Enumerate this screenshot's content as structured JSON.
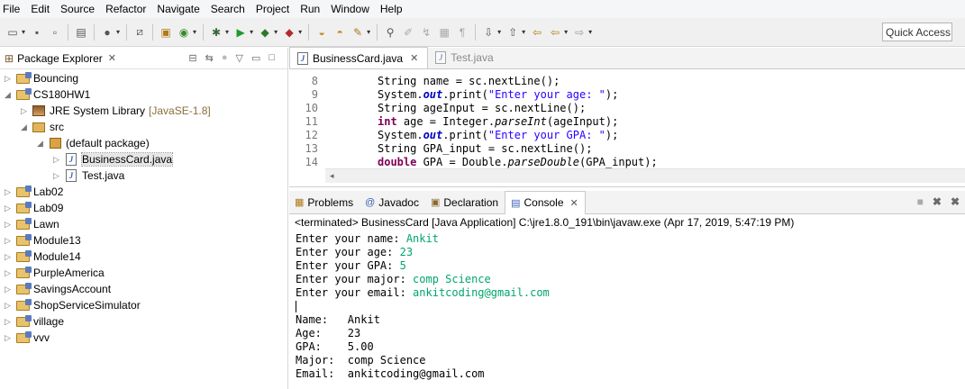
{
  "menu": [
    "File",
    "Edit",
    "Source",
    "Refactor",
    "Navigate",
    "Search",
    "Project",
    "Run",
    "Window",
    "Help"
  ],
  "toolbar": {
    "quick_access": "Quick Access"
  },
  "package_explorer": {
    "title": "Package Explorer",
    "tree": [
      {
        "label": "Bouncing",
        "extra": "",
        "icon": "project-icon",
        "arrow": "▷"
      },
      {
        "label": "CS180HW1",
        "extra": "",
        "icon": "project-icon",
        "arrow": "◢"
      },
      {
        "label": "JRE System Library",
        "extra": "[JavaSE-1.8]",
        "icon": "library-icon",
        "arrow": "▷"
      },
      {
        "label": "src",
        "extra": "",
        "icon": "source-folder-icon",
        "arrow": "◢"
      },
      {
        "label": "(default package)",
        "extra": "",
        "icon": "package-icon",
        "arrow": "◢"
      },
      {
        "label": "BusinessCard.java",
        "extra": "",
        "icon": "java-file-icon",
        "arrow": "▷"
      },
      {
        "label": "Test.java",
        "extra": "",
        "icon": "java-file-icon",
        "arrow": "▷"
      },
      {
        "label": "Lab02",
        "extra": "",
        "icon": "project-icon",
        "arrow": "▷"
      },
      {
        "label": "Lab09",
        "extra": "",
        "icon": "project-icon",
        "arrow": "▷"
      },
      {
        "label": "Lawn",
        "extra": "",
        "icon": "project-icon",
        "arrow": "▷"
      },
      {
        "label": "Module13",
        "extra": "",
        "icon": "project-icon",
        "arrow": "▷"
      },
      {
        "label": "Module14",
        "extra": "",
        "icon": "project-icon",
        "arrow": "▷"
      },
      {
        "label": "PurpleAmerica",
        "extra": "",
        "icon": "project-icon",
        "arrow": "▷"
      },
      {
        "label": "SavingsAccount",
        "extra": "",
        "icon": "project-icon",
        "arrow": "▷"
      },
      {
        "label": "ShopServiceSimulator",
        "extra": "",
        "icon": "project-icon",
        "arrow": "▷"
      },
      {
        "label": "village",
        "extra": "",
        "icon": "project-icon",
        "arrow": "▷"
      },
      {
        "label": "vvv",
        "extra": "",
        "icon": "project-icon",
        "arrow": "▷"
      }
    ]
  },
  "editor": {
    "tabs": [
      {
        "label": "BusinessCard.java",
        "active": true
      },
      {
        "label": "Test.java",
        "active": false
      }
    ],
    "lines": [
      {
        "num": "8",
        "parts": [
          [
            "t",
            "String name = sc.nextLine();"
          ]
        ]
      },
      {
        "num": "9",
        "parts": [
          [
            "t",
            "System."
          ],
          [
            "f",
            "out"
          ],
          [
            "t",
            ".print("
          ],
          [
            "s",
            "\"Enter your age: \""
          ],
          [
            "t",
            ");"
          ]
        ]
      },
      {
        "num": "10",
        "parts": [
          [
            "t",
            "String ageInput = sc.nextLine();"
          ]
        ]
      },
      {
        "num": "11",
        "parts": [
          [
            "k",
            "int"
          ],
          [
            "t",
            " age = Integer."
          ],
          [
            "m",
            "parseInt"
          ],
          [
            "t",
            "(ageInput);"
          ]
        ]
      },
      {
        "num": "12",
        "parts": [
          [
            "t",
            "System."
          ],
          [
            "f",
            "out"
          ],
          [
            "t",
            ".print("
          ],
          [
            "s",
            "\"Enter your GPA: \""
          ],
          [
            "t",
            ");"
          ]
        ]
      },
      {
        "num": "13",
        "parts": [
          [
            "t",
            "String GPA_input = sc.nextLine();"
          ]
        ]
      },
      {
        "num": "14",
        "parts": [
          [
            "k",
            "double"
          ],
          [
            "t",
            " GPA = Double."
          ],
          [
            "m",
            "parseDouble"
          ],
          [
            "t",
            "(GPA_input);"
          ]
        ]
      }
    ]
  },
  "console": {
    "tabs": [
      "Problems",
      "Javadoc",
      "Declaration",
      "Console"
    ],
    "terminated": "<terminated> BusinessCard [Java Application] C:\\jre1.8.0_191\\bin\\javaw.exe (Apr 17, 2019, 5:47:19 PM)",
    "output": [
      {
        "prompt": "Enter your name: ",
        "input": "Ankit"
      },
      {
        "prompt": "Enter your age: ",
        "input": "23"
      },
      {
        "prompt": "Enter your GPA: ",
        "input": "5"
      },
      {
        "prompt": "Enter your major: ",
        "input": "comp Science"
      },
      {
        "prompt": "Enter your email: ",
        "input": "ankitcoding@gmail.com"
      },
      {
        "prompt": "",
        "input": "",
        "caret": true
      },
      {
        "prompt": "Name:   Ankit",
        "input": ""
      },
      {
        "prompt": "Age:    23",
        "input": ""
      },
      {
        "prompt": "GPA:    5.00",
        "input": ""
      },
      {
        "prompt": "Major:  comp Science",
        "input": ""
      },
      {
        "prompt": "Email:  ankitcoding@gmail.com",
        "input": ""
      }
    ]
  }
}
